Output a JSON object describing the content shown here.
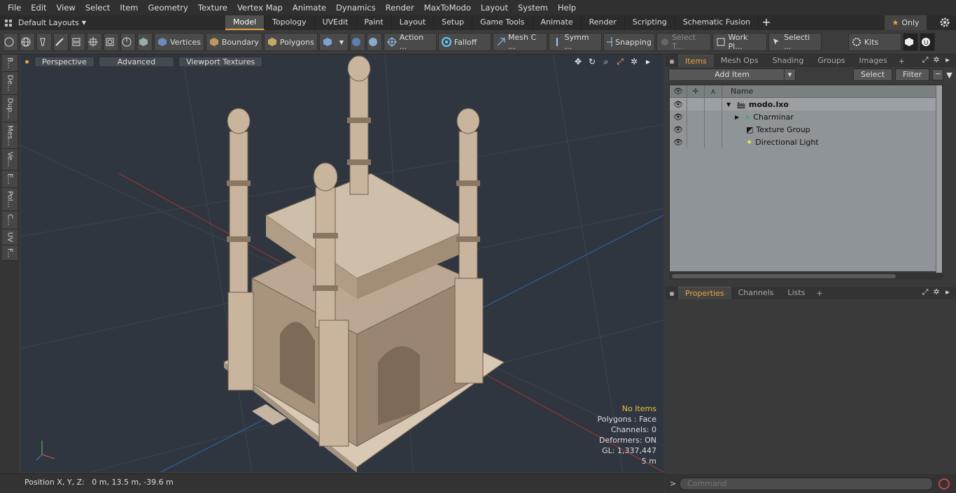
{
  "menu": [
    "File",
    "Edit",
    "View",
    "Select",
    "Item",
    "Geometry",
    "Texture",
    "Vertex Map",
    "Animate",
    "Dynamics",
    "Render",
    "MaxToModo",
    "Layout",
    "System",
    "Help"
  ],
  "layout_selector": "Default Layouts",
  "mode_tabs": [
    "Model",
    "Topology",
    "UVEdit",
    "Paint",
    "Layout",
    "Setup",
    "Game Tools",
    "Animate",
    "Render",
    "Scripting",
    "Schematic Fusion"
  ],
  "active_tab": "Model",
  "only_label": "Only",
  "toolbar": {
    "vertices": "Vertices",
    "boundary": "Boundary",
    "polygons": "Polygons",
    "action": "Action ...",
    "falloff": "Falloff",
    "mesh": "Mesh C ...",
    "symm": "Symm ...",
    "snapping": "Snapping",
    "select_t": "Select T...",
    "work_pl": "Work Pl...",
    "selecti": "Selecti ...",
    "kits": "Kits"
  },
  "left_tabs": [
    "B...",
    "De...",
    "Dup...",
    "Mes...",
    "Ve...",
    "E...",
    "Pol...",
    "C...",
    "UV",
    "F..."
  ],
  "viewport": {
    "perspective": "Perspective",
    "advanced": "Advanced",
    "viewport_textures": "Viewport Textures",
    "info": {
      "no_items": "No Items",
      "polygons": "Polygons : Face",
      "channels": "Channels: 0",
      "deformers": "Deformers: ON",
      "gl": "GL: 1,337,447",
      "scale": "5 m"
    }
  },
  "status": "Position X, Y, Z:   0 m, 13.5 m, -39.6 m",
  "items_panel": {
    "tabs": [
      "Items",
      "Mesh Ops",
      "Shading",
      "Groups",
      "Images"
    ],
    "add_item": "Add Item",
    "select": "Select",
    "filter": "Filter",
    "name_header": "Name",
    "tree": [
      {
        "label": "modo.lxo",
        "bold": true
      },
      {
        "label": "Charminar"
      },
      {
        "label": "Texture Group"
      },
      {
        "label": "Directional Light"
      }
    ]
  },
  "props_panel": {
    "tabs": [
      "Properties",
      "Channels",
      "Lists"
    ]
  },
  "command_placeholder": "Command",
  "colors": {
    "accent": "#e8a33b",
    "viewport_bg": "#2f3640",
    "model": "#c8b8a4"
  }
}
